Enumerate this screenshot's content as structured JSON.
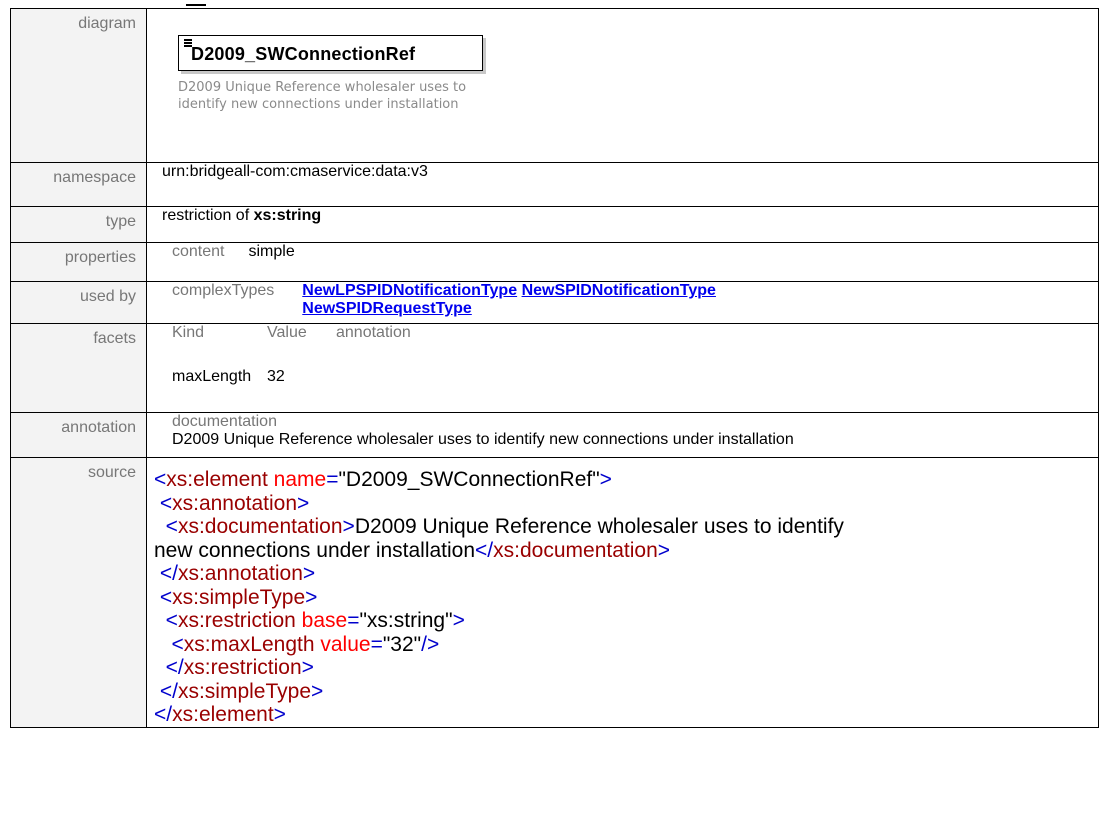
{
  "rows": {
    "diagram": {
      "label": "diagram",
      "element_name": "D2009_SWConnectionRef",
      "caption": "D2009 Unique Reference wholesaler uses to identify new connections under installation"
    },
    "namespace": {
      "label": "namespace",
      "value": "urn:bridgeall-com:cmaservice:data:v3"
    },
    "type": {
      "label": "type",
      "prefix": "restriction of ",
      "base": "xs:string"
    },
    "properties": {
      "label": "properties",
      "key": "content",
      "value": "simple"
    },
    "used_by": {
      "label": "used by",
      "kind": "complexTypes",
      "links": [
        "NewLPSPIDNotificationType",
        "NewSPIDNotificationType",
        "NewSPIDRequestType"
      ]
    },
    "facets": {
      "label": "facets",
      "headers": [
        "Kind",
        "Value",
        "annotation"
      ],
      "kind": "maxLength",
      "value": "32"
    },
    "annotation": {
      "label": "annotation",
      "header": "documentation",
      "text": "D2009 Unique Reference wholesaler uses to identify new connections under installation"
    },
    "source": {
      "label": "source",
      "element_open_tag": "xs:element",
      "element_attr": "name",
      "element_name_value": "\"D2009_SWConnectionRef\"",
      "annotation_tag": "xs:annotation",
      "documentation_tag": "xs:documentation",
      "documentation_text_1": "D2009 Unique Reference wholesaler uses to identify",
      "documentation_text_2": "new connections under installation",
      "simple_type_tag": "xs:simpleType",
      "restriction_tag": "xs:restriction",
      "restriction_attr": "base",
      "restriction_value": "\"xs:string\"",
      "max_length_tag": "xs:maxLength",
      "max_length_attr": "value",
      "max_length_value": "\"32\""
    }
  },
  "colors": {
    "tag": "#0000cc",
    "element_name": "#990000",
    "attribute": "#ff0000",
    "link": "#0000ee",
    "label_bg": "#f3f3f3"
  }
}
